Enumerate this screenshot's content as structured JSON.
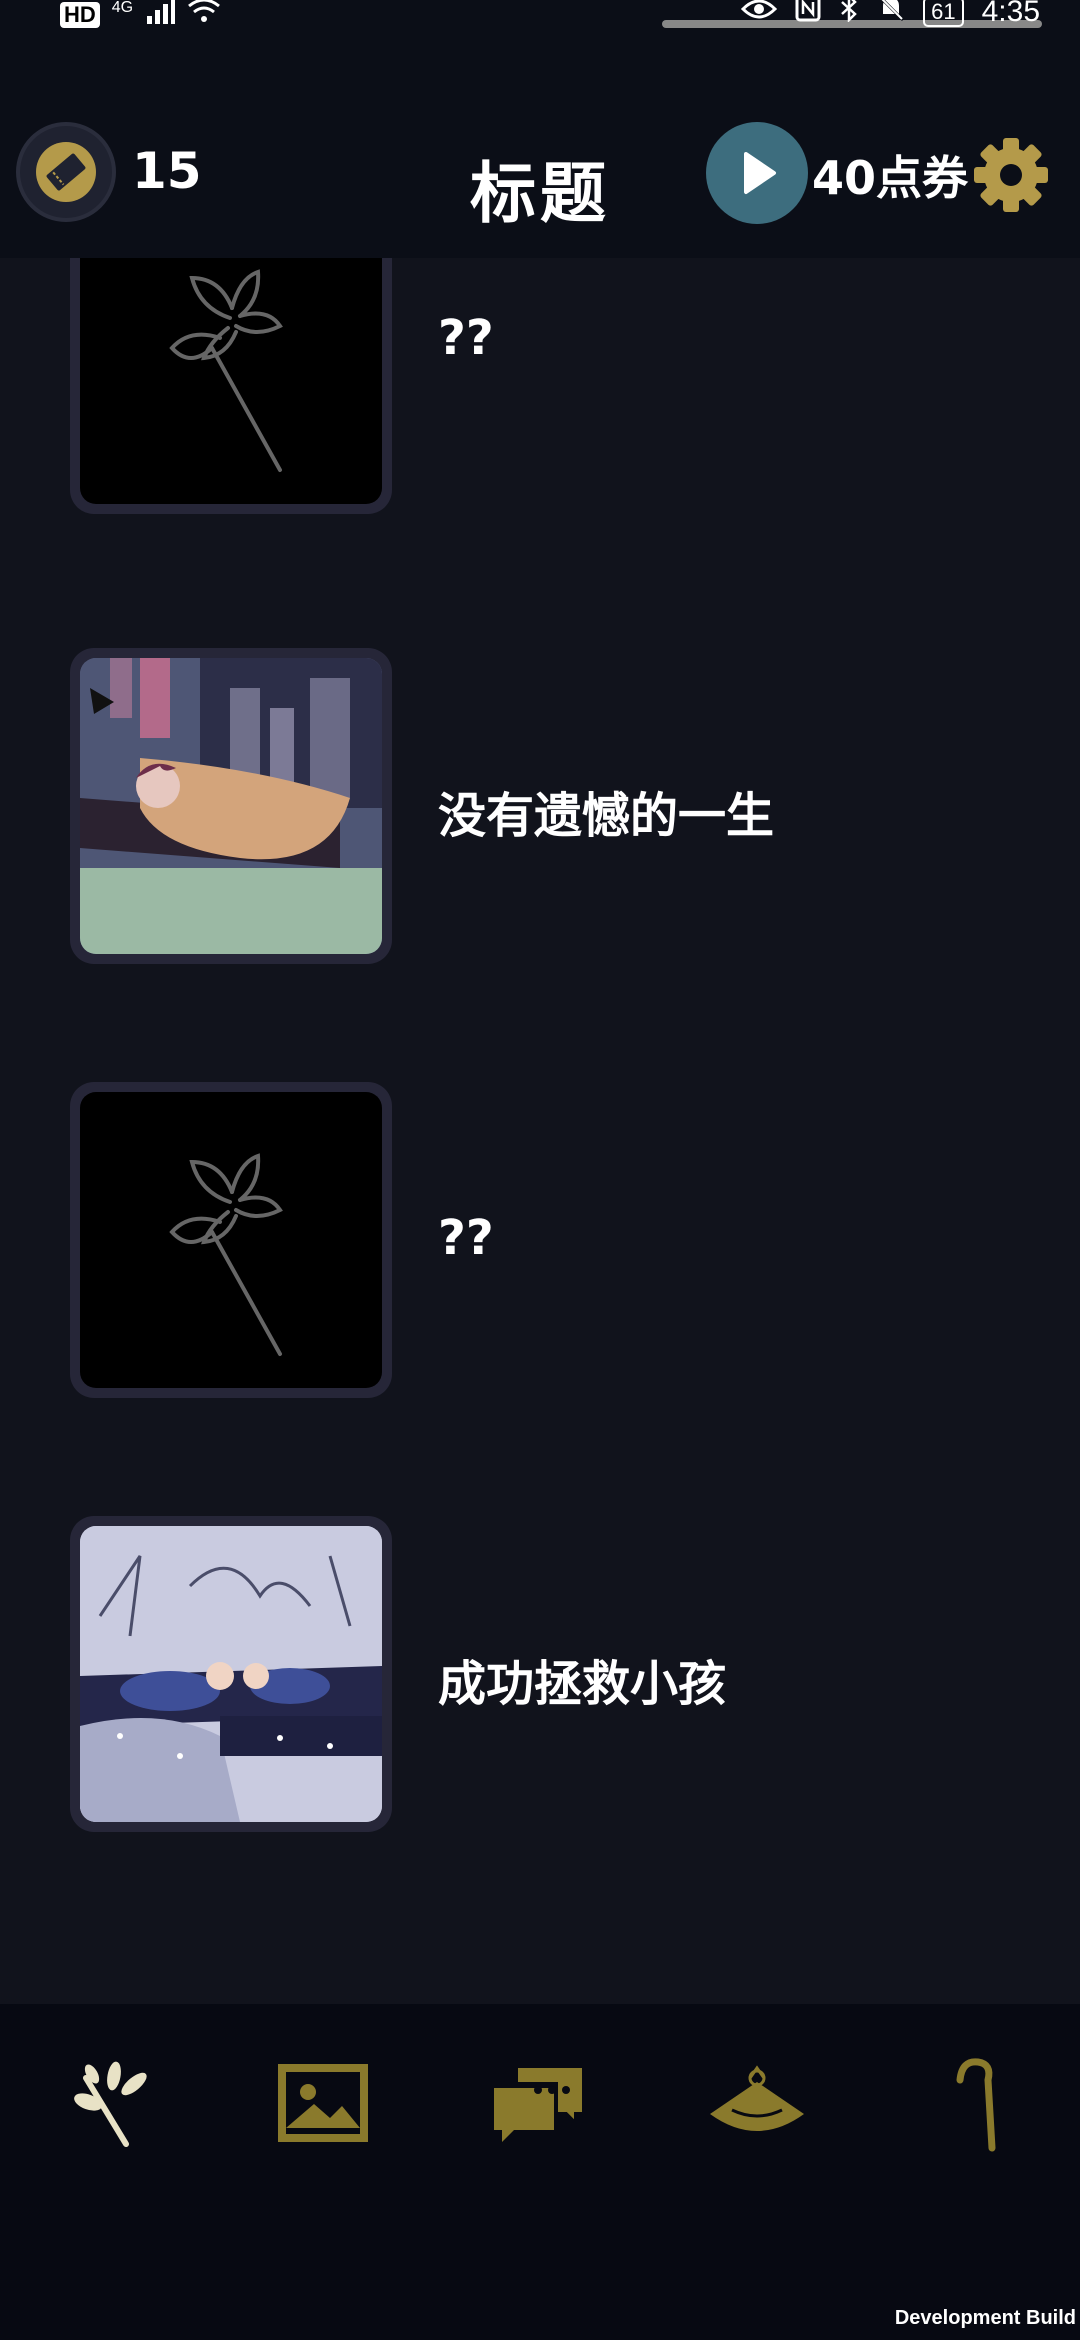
{
  "status_bar": {
    "network": "HD",
    "signal_type": "4G",
    "battery": "61",
    "time": "4:35"
  },
  "header": {
    "ticket_count": "15",
    "title": "标题",
    "points_label": "40点券"
  },
  "achievements": [
    {
      "label": "??",
      "locked": true
    },
    {
      "label": "没有遗憾的一生",
      "locked": false,
      "image": "bedroom-sleep-scene"
    },
    {
      "label": "??",
      "locked": true
    },
    {
      "label": "成功拯救小孩",
      "locked": false,
      "image": "night-rescue-scene"
    }
  ],
  "bottom_nav": {
    "items": [
      "branch-icon",
      "picture-icon",
      "chat-icon",
      "hat-icon",
      "cane-icon"
    ],
    "active_color": "#e8e2c6",
    "inactive_color": "#8a7a2c"
  },
  "footer": {
    "build_label": "Development Build"
  },
  "colors": {
    "background": "#11131c",
    "header": "#0b0e17",
    "gold": "#b49a4a",
    "play_teal": "#3d6d7e"
  }
}
